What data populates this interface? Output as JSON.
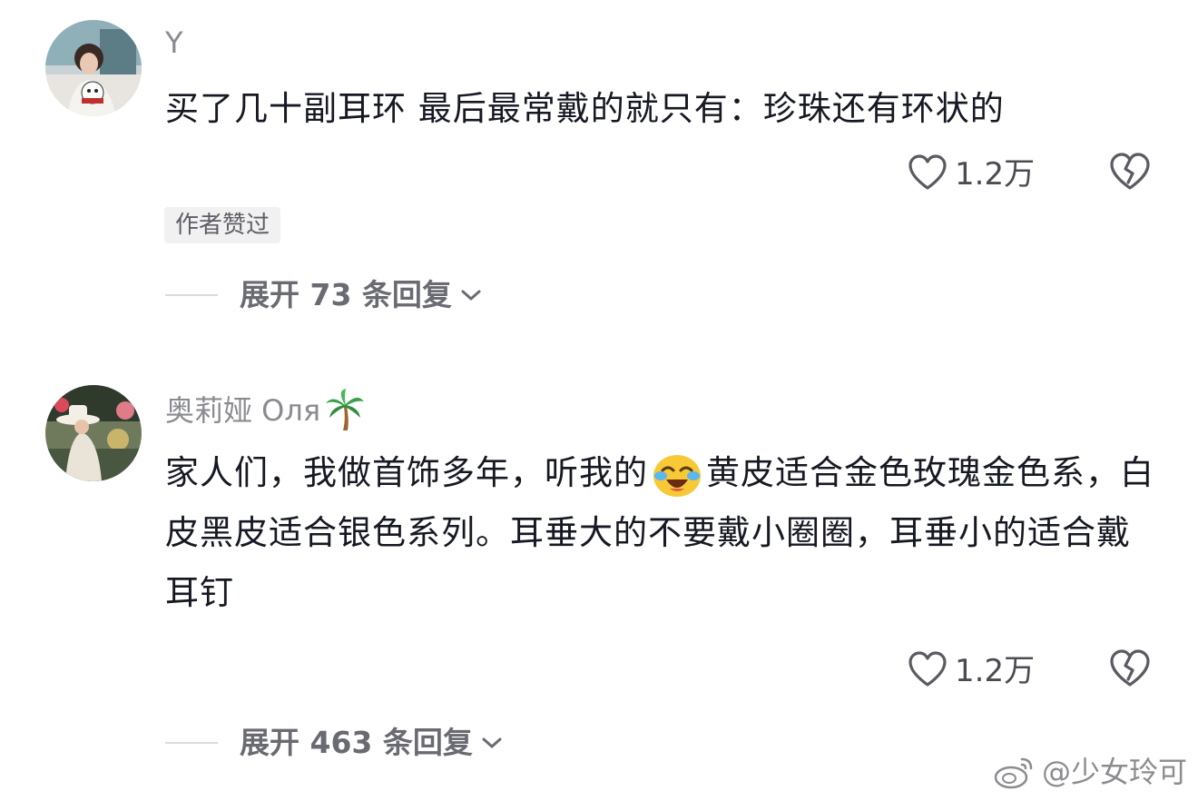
{
  "comments": [
    {
      "username": "Y",
      "text": "买了几十副耳环 最后最常戴的就只有：珍珠还有环状的",
      "likes": "1.2万",
      "author_badge": "作者赞过",
      "expand_label": "展开 73 条回复"
    },
    {
      "username": "奥莉娅 Оля",
      "text_part1": "家人们，我做首饰多年，听我的",
      "text_part2": "黄皮适合金色玫瑰金色系，白皮黑皮适合银色系列。耳垂大的不要戴小圈圈，耳垂小的适合戴耳钉",
      "likes": "1.2万",
      "expand_label": "展开 463 条回复"
    }
  ],
  "watermark": "@少女玲可",
  "icons": {
    "like": "heart-outline-icon",
    "dislike": "broken-heart-icon",
    "expand": "chevron-down-icon",
    "name_emoji": "palm-tree-icon",
    "inline_emoji": "crying-laughing-face-icon",
    "watermark_logo": "weibo-logo-icon"
  },
  "colors": {
    "text": "#161823",
    "username": "#8a8b91",
    "muted": "#6a6b72"
  }
}
